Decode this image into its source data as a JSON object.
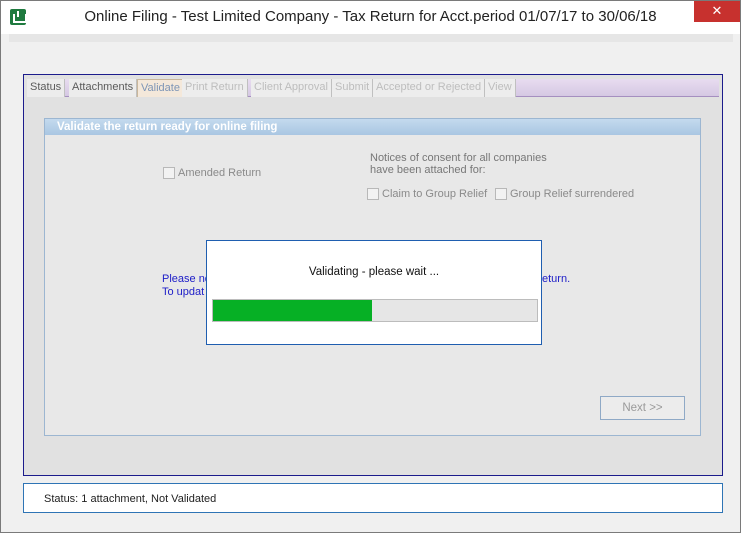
{
  "window": {
    "title": "Online Filing - Test Limited Company - Tax Return for Acct.period 01/07/17 to 30/06/18",
    "close_glyph": "✕"
  },
  "tabs": [
    {
      "label": "Status",
      "state": "normal"
    },
    {
      "label": "Attachments",
      "state": "normal"
    },
    {
      "label": "Validate",
      "state": "active"
    },
    {
      "label": "Print Return",
      "state": "disabled"
    },
    {
      "label": "Client Approval",
      "state": "disabled"
    },
    {
      "label": "Submit",
      "state": "disabled"
    },
    {
      "label": "Accepted or Rejected",
      "state": "disabled"
    },
    {
      "label": "View",
      "state": "disabled"
    }
  ],
  "validate_panel": {
    "header": "Validate the return ready for online filing",
    "amended_return_label": "Amended Return",
    "consent_line1": "Notices of consent for all companies",
    "consent_line2": "have been attached for:",
    "claim_group_relief_label": "Claim to Group Relief",
    "group_relief_surrendered_label": "Group Relief surrendered",
    "note_line1_start": "Please no",
    "note_line1_end": "eturn.",
    "note_line2_start": "To updat",
    "next_button": "Next >>"
  },
  "progress": {
    "label": "Validating - please wait ...",
    "fraction": 0.49,
    "fill_color": "#06b025"
  },
  "status_bar": {
    "text": "Status: 1 attachment, Not Validated"
  }
}
